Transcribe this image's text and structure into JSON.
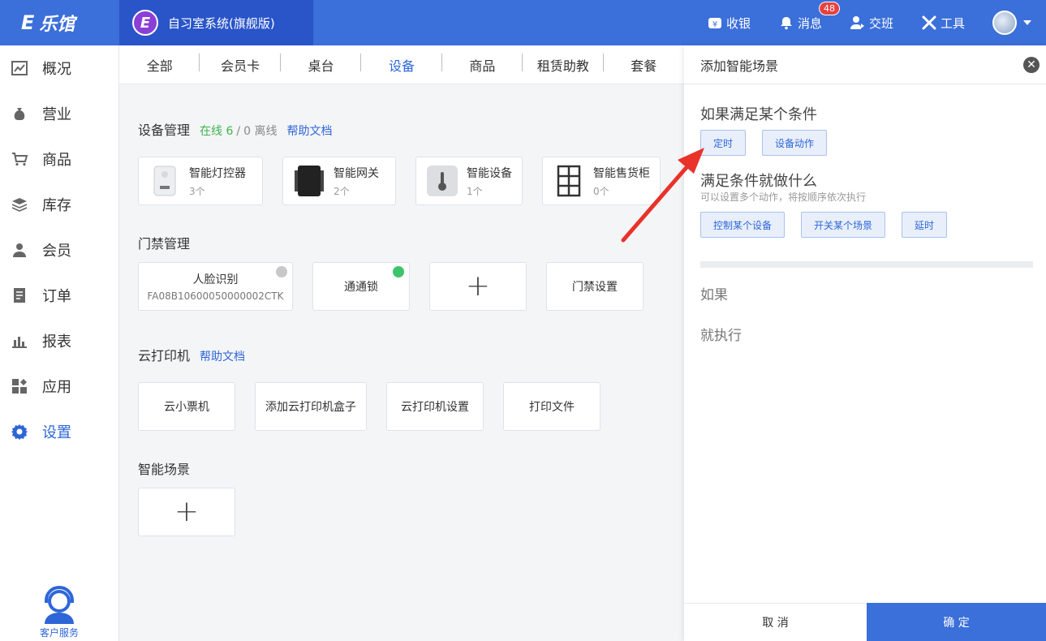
{
  "app": {
    "logo_text": "乐馆",
    "brand_title": "自习室系统(旗舰版)"
  },
  "header": {
    "cashier": "收银",
    "messages": "消息",
    "message_count": "48",
    "handover": "交班",
    "tools": "工具"
  },
  "sidebar": {
    "items": [
      {
        "label": "概况",
        "icon": "chart-icon"
      },
      {
        "label": "营业",
        "icon": "money-bag-icon"
      },
      {
        "label": "商品",
        "icon": "cart-icon"
      },
      {
        "label": "库存",
        "icon": "layers-icon"
      },
      {
        "label": "会员",
        "icon": "user-icon"
      },
      {
        "label": "订单",
        "icon": "order-icon"
      },
      {
        "label": "报表",
        "icon": "bar-chart-icon"
      },
      {
        "label": "应用",
        "icon": "apps-icon"
      },
      {
        "label": "设置",
        "icon": "gear-icon"
      }
    ],
    "active": "设置",
    "service": "客户服务"
  },
  "tabs": [
    "全部",
    "会员卡",
    "桌台",
    "设备",
    "商品",
    "租赁助教",
    "套餐"
  ],
  "active_tab": "设备",
  "device_mgmt": {
    "title": "设备管理",
    "online": "在线 6",
    "slash": "/",
    "offline": "0 离线",
    "help": "帮助文档",
    "devices": [
      {
        "name": "智能灯控器",
        "count": "3个"
      },
      {
        "name": "智能网关",
        "count": "2个"
      },
      {
        "name": "智能设备",
        "count": "1个"
      },
      {
        "name": "智能售货柜",
        "count": "0个"
      }
    ]
  },
  "access": {
    "title": "门禁管理",
    "face_name": "人脸识别",
    "face_id": "FA08B10600050000002CTK",
    "lock": "通通锁",
    "settings": "门禁设置"
  },
  "printer": {
    "title": "云打印机",
    "help": "帮助文档",
    "items": [
      "云小票机",
      "添加云打印机盒子",
      "云打印机设置",
      "打印文件"
    ]
  },
  "scene": {
    "title": "智能场景"
  },
  "panel": {
    "title": "添加智能场景",
    "cond_title": "如果满足某个条件",
    "cond_options": [
      "定时",
      "设备动作"
    ],
    "action_title": "满足条件就做什么",
    "action_sub": "可以设置多个动作，将按顺序依次执行",
    "action_options": [
      "控制某个设备",
      "开关某个场景",
      "延时"
    ],
    "if_label": "如果",
    "then_label": "就执行",
    "cancel": "取 消",
    "ok": "确 定"
  },
  "colors": {
    "primary": "#3b6fd9",
    "online": "#3cb44b",
    "offline_dot": "#c8c8c8",
    "online_dot": "#3cc46a",
    "arrow": "#e8322a"
  }
}
